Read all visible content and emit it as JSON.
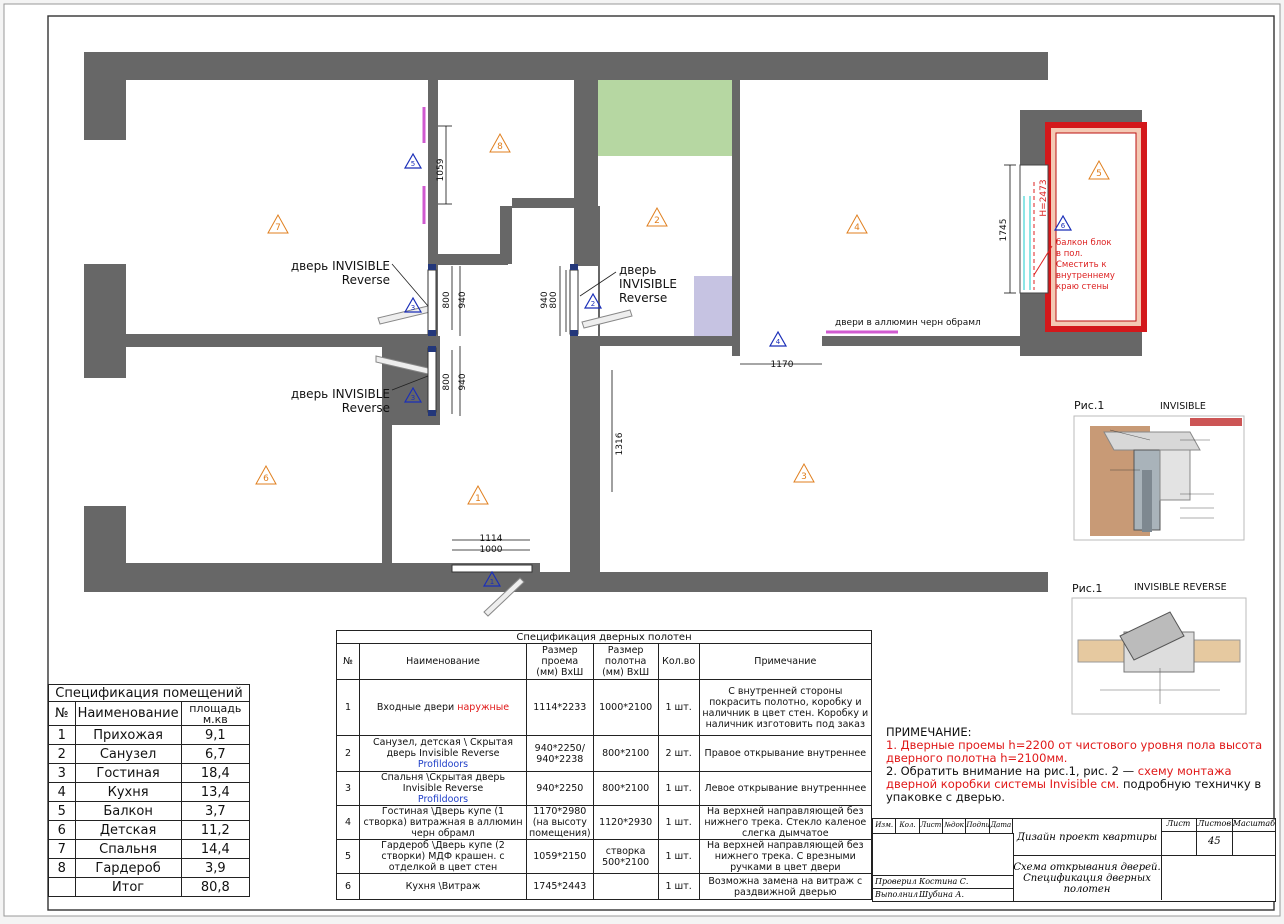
{
  "plan": {
    "room_numbers": [
      "1",
      "2",
      "3",
      "4",
      "5",
      "6",
      "7",
      "8"
    ],
    "door_marks": [
      "1",
      "2",
      "3",
      "4",
      "5",
      "6"
    ],
    "dimensions": {
      "d1059": "1059",
      "d800a": "800",
      "d940a": "940",
      "d940b": "940",
      "d800b": "800",
      "d800c": "800",
      "d940c": "940",
      "d1316": "1316",
      "d1114": "1114",
      "d1000": "1000",
      "d1170": "1170",
      "d1745": "1745",
      "dH2473": "H=2473"
    },
    "callouts": {
      "invisible_reverse_top_1": "дверь INVISIBLE",
      "invisible_reverse_top_2": "Reverse",
      "invisible_reverse_bot_1": "дверь INVISIBLE",
      "invisible_reverse_bot_2": "Reverse",
      "invisible_reverse_mid_1": "дверь",
      "invisible_reverse_mid_2": "INVISIBLE",
      "invisible_reverse_mid_3": "Reverse",
      "alum_door": "двери в аллюмин черн обрамл",
      "balcony_1": "балкон блок",
      "balcony_2": "в пол.",
      "balcony_3": "Сместить к",
      "balcony_4": "внутреннему",
      "balcony_5": "краю стены"
    },
    "colors": {
      "wall": "#676767",
      "green_zone": "#b6d7a2",
      "purple_zone": "#c6c3e2",
      "balcony_red": "#d3181b",
      "balcony_hatch": "#f4c9b4",
      "triangle": "#e07f1f",
      "door_mark": "#1b2fb8",
      "door_leaf": "#d05ad0"
    }
  },
  "figures": {
    "fig1_label": "Рис.1",
    "fig1_title": "INVISIBLE",
    "fig2_label": "Рис.1",
    "fig2_title": "INVISIBLE REVERSE"
  },
  "rooms_table": {
    "title": "Спецификация помещений",
    "headers": [
      "№",
      "Наименование",
      "площадь м.кв"
    ],
    "rows": [
      [
        "1",
        "Прихожая",
        "9,1"
      ],
      [
        "2",
        "Санузел",
        "6,7"
      ],
      [
        "3",
        "Гостиная",
        "18,4"
      ],
      [
        "4",
        "Кухня",
        "13,4"
      ],
      [
        "5",
        "Балкон",
        "3,7"
      ],
      [
        "6",
        "Детская",
        "11,2"
      ],
      [
        "7",
        "Спальня",
        "14,4"
      ],
      [
        "8",
        "Гардероб",
        "3,9"
      ]
    ],
    "total_label": "Итог",
    "total_value": "80,8"
  },
  "doors_table": {
    "title": "Спецификация дверных полотен",
    "headers": {
      "num": "№",
      "name": "Наименование",
      "opening": "Размер проема (мм) ВхШ",
      "leaf": "Размер полотна (мм) ВхШ",
      "qty": "Кол.во",
      "note": "Примечание"
    },
    "rows": [
      {
        "num": "1",
        "name": "Входные двери",
        "name_red": "наружные",
        "name_link": "",
        "opening": "1114*2233",
        "leaf": "1000*2100",
        "qty": "1 шт.",
        "note": "С внутренней стороны покрасить полотно, коробку и наличник в цвет стен. Коробку и наличник изготовить под заказ"
      },
      {
        "num": "2",
        "name": "Санузел, детская \\ Скрытая дверь Invisible Reverse",
        "name_red": "",
        "name_link": "Profildoors",
        "opening": "940*2250/ 940*2238",
        "leaf": "800*2100",
        "qty": "2 шт.",
        "note": "Правое открывание внутреннее"
      },
      {
        "num": "3",
        "name": "Спальня \\Скрытая дверь Invisible Reverse",
        "name_red": "",
        "name_link": "Profildoors",
        "opening": "940*2250",
        "leaf": "800*2100",
        "qty": "1 шт.",
        "note": "Левое открывание внутренннее"
      },
      {
        "num": "4",
        "name": "Гостиная \\Дверь купе (1 створка) витражная в аллюмин черн обрамл",
        "name_red": "",
        "name_link": "",
        "opening": "1170*2980 (на высоту помещения)",
        "leaf": "1120*2930",
        "qty": "1 шт.",
        "note": "На верхней направляющей без нижнего трека. Стекло каленое слегка дымчатое"
      },
      {
        "num": "5",
        "name": "Гардероб \\Дверь купе (2 створки) МДФ крашен. с отделкой в цвет стен",
        "name_red": "",
        "name_link": "",
        "opening": "1059*2150",
        "leaf": "створка 500*2100",
        "qty": "1 шт.",
        "note": "На верхней направляющей без нижнего трека. С врезными ручками в цвет двери"
      },
      {
        "num": "6",
        "name": "Кухня \\Витраж",
        "name_red": "",
        "name_link": "",
        "opening": "1745*2443",
        "leaf": "",
        "qty": "1 шт.",
        "note": "Возможна замена на витраж с раздвижной дверью"
      }
    ]
  },
  "notes": {
    "heading": "ПРИМЕЧАНИЕ:",
    "n1": "1. Дверные проемы h=2200 от чистового уровня пола высота дверного полотна h=2100мм.",
    "n2_a": "2. Обратить внимание на рис.1, рис. 2 —",
    "n2_red": "схему монтажа дверной коробки системы Invisible см.",
    "n2_b": "подробную техничку в упаковке с дверью."
  },
  "stamp": {
    "cols": [
      "Изм.",
      "Кол.",
      "Лист",
      "№док",
      "Подпись",
      "Дата"
    ],
    "checked_label": "Проверил",
    "checked_name": "Костина С.",
    "made_label": "Выполнил",
    "made_name": "Шубина А.",
    "project": "Дизайн проект квартиры",
    "sheet_title": "Схема открывания дверей. Спецификация дверных полотен",
    "sheet_label": "Лист",
    "sheets_label": "Листов",
    "scale_label": "Масштаб",
    "sheets_value": "45"
  }
}
